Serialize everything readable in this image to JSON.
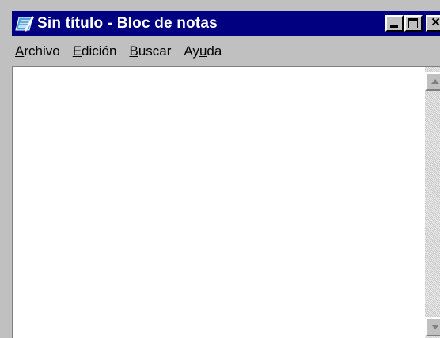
{
  "window": {
    "title": "Sin título - Bloc de notas",
    "title_bar_color": "#000080",
    "app_icon": "notepad-icon",
    "controls": {
      "minimize_icon": "minimize-icon",
      "maximize_icon": "maximize-icon",
      "close_label": "×"
    }
  },
  "menu": {
    "items": [
      {
        "accel": "A",
        "rest": "rchivo"
      },
      {
        "accel": "E",
        "rest": "dición"
      },
      {
        "accel": "B",
        "rest": "uscar"
      },
      {
        "pre": "Ay",
        "accel": "u",
        "rest": "da"
      }
    ]
  },
  "editor": {
    "content": ""
  },
  "scrollbar": {
    "up_icon": "arrow-up-icon",
    "down_icon": "arrow-down-icon"
  }
}
